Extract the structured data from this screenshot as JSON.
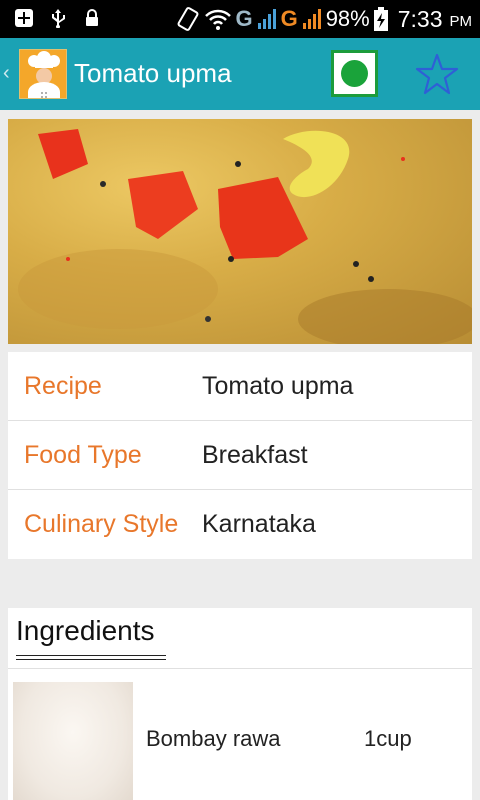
{
  "status_bar": {
    "net1": "G",
    "net2": "G",
    "battery": "98%",
    "time": "7:33",
    "ampm": "PM"
  },
  "action_bar": {
    "title": "Tomato upma",
    "back_icon": "chevron-left-icon",
    "logo_icon": "chef-icon",
    "veg_icon": "veg-mark-icon",
    "favorite_icon": "star-outline-icon"
  },
  "details": {
    "recipe": {
      "label": "Recipe",
      "value": "Tomato upma"
    },
    "food_type": {
      "label": "Food Type",
      "value": "Breakfast"
    },
    "culinary_style": {
      "label": "Culinary Style",
      "value": "Karnataka"
    }
  },
  "ingredients": {
    "title": "Ingredients",
    "items": [
      {
        "name": "Bombay rawa",
        "qty": "1cup"
      }
    ]
  },
  "colors": {
    "action_bar": "#1ba2b4",
    "label": "#e8772b",
    "veg": "#1aa33a",
    "star": "#2f5fd6"
  }
}
